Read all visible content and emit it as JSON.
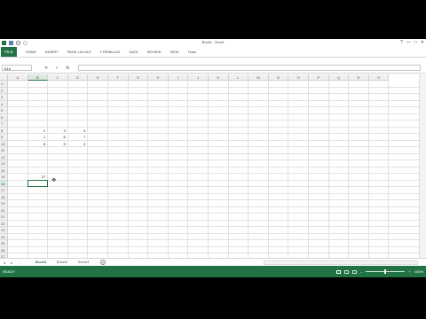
{
  "window": {
    "title": "Book1 - Excel",
    "controls": [
      "?",
      "—",
      "□",
      "✕"
    ]
  },
  "ribbon": {
    "file_label": "FILE",
    "tabs": [
      "HOME",
      "INSERT",
      "PAGE LAYOUT",
      "FORMULAS",
      "DATA",
      "REVIEW",
      "VIEW",
      "Team"
    ]
  },
  "formula_bar": {
    "name_box": "B16",
    "cancel_symbol": "✕",
    "enter_symbol": "✓",
    "fx_symbol": "fx",
    "value": ""
  },
  "grid": {
    "columns": [
      "A",
      "B",
      "C",
      "D",
      "E",
      "F",
      "G",
      "H",
      "I",
      "J",
      "K",
      "L",
      "M",
      "N",
      "O",
      "P",
      "Q",
      "R",
      "S"
    ],
    "rows": [
      "1",
      "2",
      "3",
      "4",
      "5",
      "6",
      "7",
      "8",
      "9",
      "10",
      "11",
      "12",
      "13",
      "14",
      "15",
      "16",
      "17",
      "18",
      "19",
      "20",
      "21",
      "22",
      "23",
      "24",
      "25",
      "26",
      "27",
      "28",
      "29",
      "30",
      "31",
      "32"
    ],
    "cells": {
      "B8": "2",
      "C8": "3",
      "D8": "4",
      "B9": "1",
      "C9": "8",
      "D9": "7",
      "B10": "8",
      "C10": "9",
      "D10": "2",
      "B15": "27"
    },
    "active_cell": "B16"
  },
  "sheets": {
    "tabs": [
      "Sheet1",
      "Sheet2",
      "Sheet3"
    ],
    "active": "Sheet1",
    "add_symbol": "+",
    "nav": [
      "◂",
      "▸",
      "..."
    ]
  },
  "status": {
    "left": "READY",
    "zoom": "100%",
    "zoom_level_percent": 100
  },
  "colors": {
    "accent": "#217346",
    "gridline": "#e1e1e1"
  }
}
